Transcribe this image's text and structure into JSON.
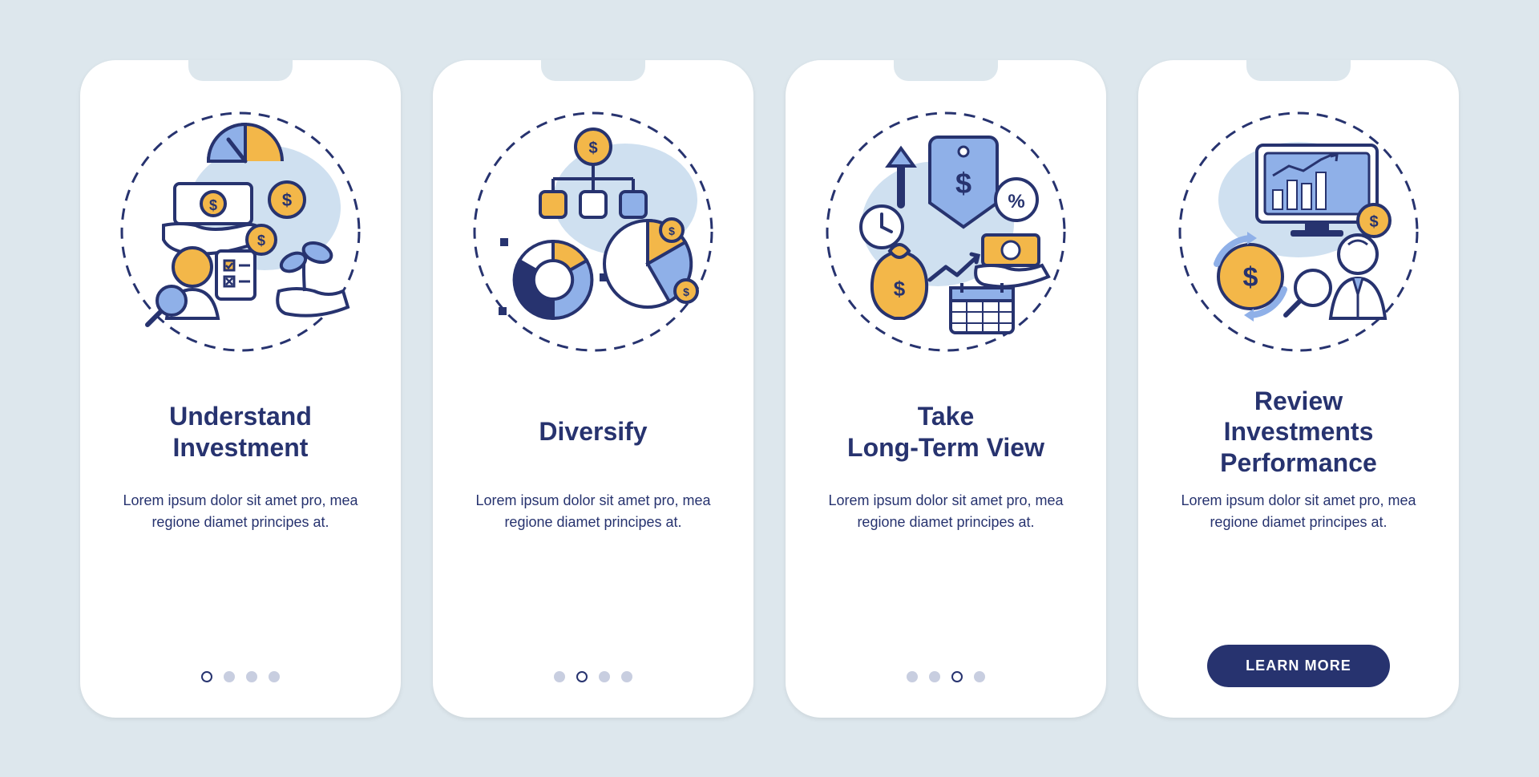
{
  "colors": {
    "navy": "#27336f",
    "gold": "#f3b749",
    "blue": "#8fb0e8",
    "bg": "#dde7ed",
    "white": "#ffffff",
    "inactive": "#c8cee0"
  },
  "cta_label": "LEARN MORE",
  "screens": [
    {
      "id": "understand-investment",
      "title": "Understand\nInvestment",
      "description": "Lorem ipsum dolor sit amet pro, mea regione diamet principes at.",
      "dots_total": 4,
      "dot_active_index": 0,
      "has_cta": false,
      "icon": "understand-investment-icon"
    },
    {
      "id": "diversify",
      "title": "Diversify",
      "description": "Lorem ipsum dolor sit amet pro, mea regione diamet principes at.",
      "dots_total": 4,
      "dot_active_index": 1,
      "has_cta": false,
      "icon": "diversify-icon"
    },
    {
      "id": "long-term-view",
      "title": "Take\nLong-Term View",
      "description": "Lorem ipsum dolor sit amet pro, mea regione diamet principes at.",
      "dots_total": 4,
      "dot_active_index": 2,
      "has_cta": false,
      "icon": "long-term-view-icon"
    },
    {
      "id": "review-performance",
      "title": "Review\nInvestments\nPerformance",
      "description": "Lorem ipsum dolor sit amet pro, mea regione diamet principes at.",
      "dots_total": 4,
      "dot_active_index": 3,
      "has_cta": true,
      "icon": "review-performance-icon"
    }
  ]
}
